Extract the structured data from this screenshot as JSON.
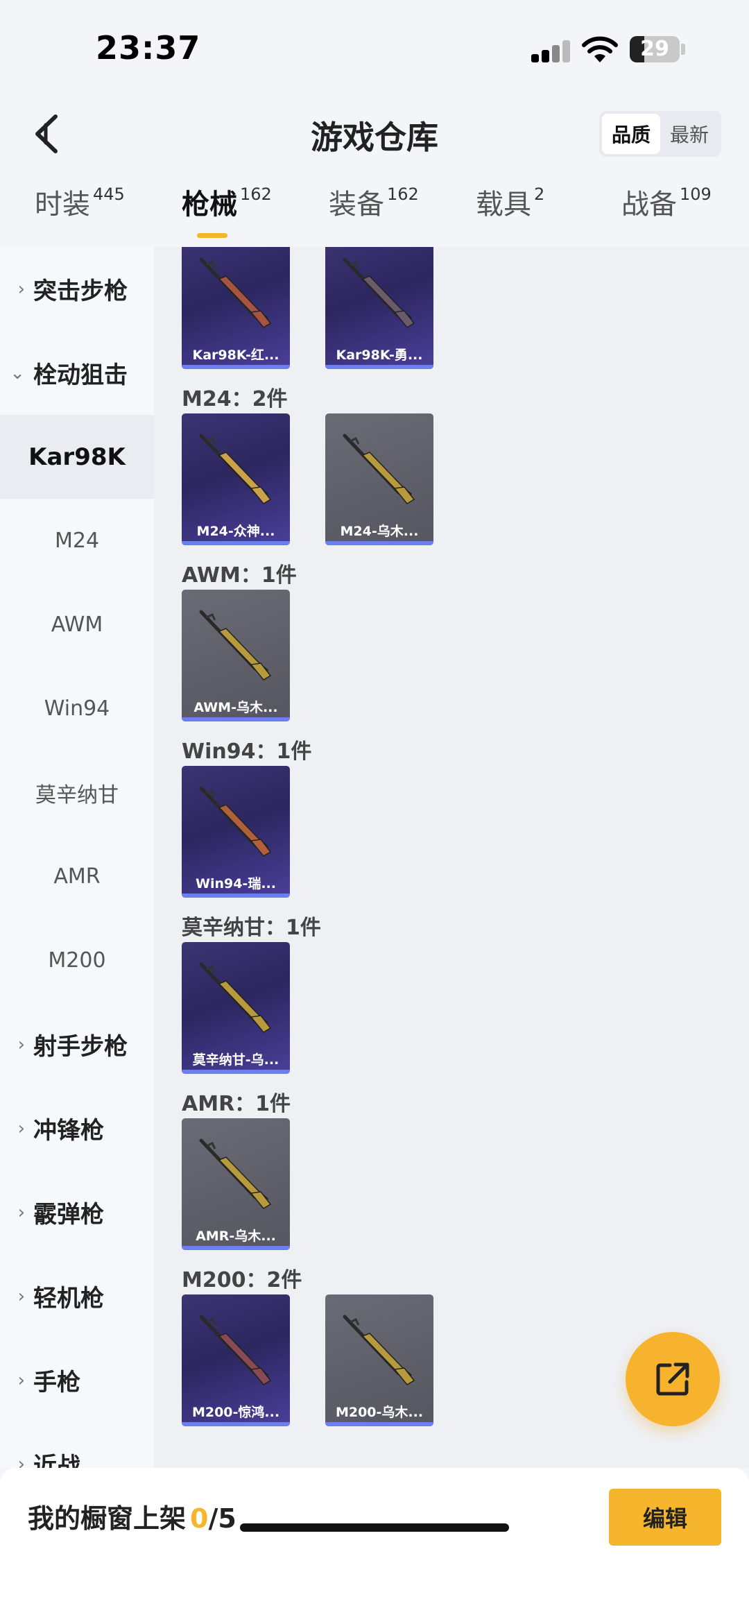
{
  "status_bar": {
    "time": "23:37",
    "battery": "29",
    "battery_level": 0.29
  },
  "header": {
    "title": "游戏仓库",
    "sort_options": [
      "品质",
      "最新"
    ],
    "active_sort": "品质"
  },
  "tabs": [
    {
      "label": "时装",
      "count": "445"
    },
    {
      "label": "枪械",
      "count": "162"
    },
    {
      "label": "装备",
      "count": "162"
    },
    {
      "label": "载具",
      "count": "2"
    },
    {
      "label": "战备",
      "count": "109"
    }
  ],
  "active_tab": "枪械",
  "sidebar": {
    "items": [
      {
        "label": "突击步枪",
        "type": "group",
        "expanded": false
      },
      {
        "label": "栓动狙击",
        "type": "group",
        "expanded": true
      },
      {
        "label": "Kar98K",
        "type": "sub",
        "active": true
      },
      {
        "label": "M24",
        "type": "sub"
      },
      {
        "label": "AWM",
        "type": "sub"
      },
      {
        "label": "Win94",
        "type": "sub"
      },
      {
        "label": "莫辛纳甘",
        "type": "sub"
      },
      {
        "label": "AMR",
        "type": "sub"
      },
      {
        "label": "M200",
        "type": "sub"
      },
      {
        "label": "射手步枪",
        "type": "group",
        "expanded": false
      },
      {
        "label": "冲锋枪",
        "type": "group",
        "expanded": false
      },
      {
        "label": "霰弹枪",
        "type": "group",
        "expanded": false
      },
      {
        "label": "轻机枪",
        "type": "group",
        "expanded": false
      },
      {
        "label": "手枪",
        "type": "group",
        "expanded": false
      },
      {
        "label": "近战",
        "type": "group",
        "expanded": false
      }
    ]
  },
  "sections": [
    {
      "header": "",
      "items": [
        {
          "name": "Kar98K-红...",
          "rarity": "purple",
          "gun_color": "#a55440"
        },
        {
          "name": "Kar98K-勇...",
          "rarity": "purple",
          "gun_color": "#6a5a6a"
        }
      ]
    },
    {
      "header": "M24：2件",
      "items": [
        {
          "name": "M24-众神...",
          "rarity": "purple",
          "gun_color": "#c9a24a"
        },
        {
          "name": "M24-乌木...",
          "rarity": "gray",
          "gun_color": "#b79a3c"
        }
      ]
    },
    {
      "header": "AWM：1件",
      "items": [
        {
          "name": "AWM-乌木...",
          "rarity": "gray",
          "gun_color": "#b79a3c"
        }
      ]
    },
    {
      "header": "Win94：1件",
      "items": [
        {
          "name": "Win94-瑞...",
          "rarity": "purple",
          "gun_color": "#b0603a"
        }
      ]
    },
    {
      "header": "莫辛纳甘：1件",
      "items": [
        {
          "name": "莫辛纳甘-乌...",
          "rarity": "purple",
          "gun_color": "#b79a3c"
        }
      ]
    },
    {
      "header": "AMR：1件",
      "items": [
        {
          "name": "AMR-乌木...",
          "rarity": "gray",
          "gun_color": "#b79a3c"
        }
      ]
    },
    {
      "header": "M200：2件",
      "items": [
        {
          "name": "M200-惊鸿...",
          "rarity": "purple",
          "gun_color": "#8a4a55"
        },
        {
          "name": "M200-乌木...",
          "rarity": "gray",
          "gun_color": "#b79a3c"
        }
      ]
    }
  ],
  "bottom_bar": {
    "shelf_label": "我的橱窗上架",
    "shelf_current": "0",
    "shelf_total": "/5",
    "edit_label": "编辑"
  },
  "icons": {
    "back": "chevron-left-icon",
    "fab": "share-external-icon"
  },
  "colors": {
    "accent": "#f5b52c",
    "purple_card": "#3b3472",
    "gray_card": "#5f6068",
    "rarity_bar": "#6c7ff0"
  }
}
